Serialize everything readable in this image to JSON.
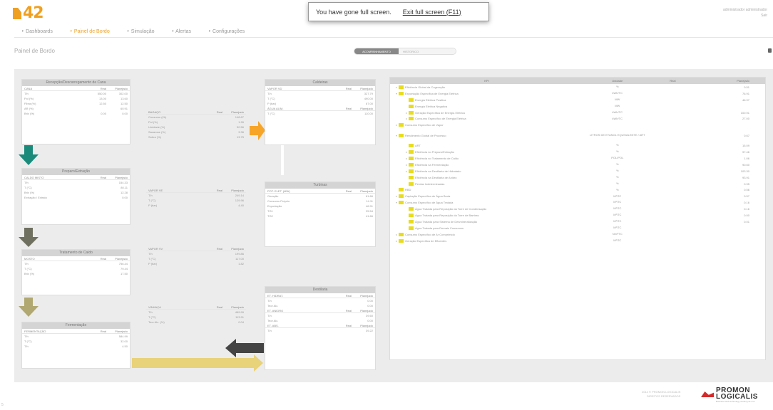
{
  "app": {
    "logo_text": "42",
    "user_line1": "administrador administrador",
    "user_line2": "Sair"
  },
  "fullscreen": {
    "message": "You have gone full screen.",
    "exit_label": "Exit full screen (F11)"
  },
  "nav": [
    {
      "label": "‣ Dashboards"
    },
    {
      "label": "‣ Painel de Bordo"
    },
    {
      "label": "‣ Simulação"
    },
    {
      "label": "‣ Alertas"
    },
    {
      "label": "‣ Configurações"
    }
  ],
  "page": {
    "title": "Painel de Bordo",
    "toggle_on": "ACOMPANHAMENTO",
    "toggle_off": "HISTORICO"
  },
  "panels": {
    "recepcao": {
      "title": "Recepção/Descarregamento de Cana",
      "cols": [
        "CANA",
        "Real",
        "Planejado"
      ],
      "rows": [
        [
          "T/h",
          "550.00",
          "302.00"
        ],
        [
          "Pol (%)",
          "13.00",
          "13.60"
        ],
        [
          "Fibra (%)",
          "12.50",
          "12.50"
        ],
        [
          "AR (%)",
          "",
          "60.91"
        ],
        [
          "Brix (%)",
          "0.00",
          "0.00"
        ]
      ]
    },
    "preparo": {
      "title": "Preparo/Extração",
      "cols": [
        "CALDO MISTO",
        "Real",
        "Planejado"
      ],
      "rows": [
        [
          "T/h",
          "",
          "154.33"
        ],
        [
          "T (°C)",
          "",
          "80.11"
        ],
        [
          "Brix (%)",
          "",
          "12.28"
        ],
        [
          "Extração / Extrato",
          "",
          "0.00"
        ]
      ]
    },
    "tratamento": {
      "title": "Tratamento de Caldo",
      "cols": [
        "MOSTO",
        "Real",
        "Planejado"
      ],
      "rows": [
        [
          "T/h",
          "",
          "756.44"
        ],
        [
          "T (°C)",
          "",
          "79.44"
        ],
        [
          "Brix (%)",
          "",
          "17.50"
        ]
      ]
    },
    "fermentacao": {
      "title": "Fermentação",
      "cols": [
        "FERMENTAÇÃO",
        "Real",
        "Planejado"
      ],
      "rows": [
        [
          "T/h",
          "",
          "584.99"
        ],
        [
          "T (°C)",
          "",
          "32.00"
        ],
        [
          "T/h",
          "",
          "4.50"
        ]
      ]
    },
    "bagaco": {
      "cols": [
        "BAGAÇO",
        "Real",
        "Planejado"
      ],
      "rows": [
        [
          "Consumo (t/h)",
          "",
          "148.87"
        ],
        [
          "Pol (%)",
          "",
          "1.26"
        ],
        [
          "Umidade (%)",
          "",
          "50.56"
        ],
        [
          "Sacarose (%)",
          "",
          "3.36"
        ],
        [
          "Sobra (%)",
          "",
          "13.75"
        ]
      ]
    },
    "vapor_ve": {
      "cols": [
        "VAPOR VE",
        "Real",
        "Planejado"
      ],
      "rows": [
        [
          "T/h",
          "",
          "249.14"
        ],
        [
          "T (°C)",
          "",
          "129.96"
        ],
        [
          "P (bar)",
          "",
          "4.40"
        ]
      ]
    },
    "vapor_vv": {
      "cols": [
        "VAPOR VV",
        "Real",
        "Planejado"
      ],
      "rows": [
        [
          "T/h",
          "",
          "199.86"
        ],
        [
          "T (°C)",
          "",
          "117.00"
        ],
        [
          "P (bar)",
          "",
          "1.82"
        ]
      ]
    },
    "vinhaca": {
      "cols": [
        "VINHAÇA",
        "Real",
        "Planejado"
      ],
      "rows": [
        [
          "T/h",
          "",
          "469.99"
        ],
        [
          "T (°C)",
          "",
          "113.91"
        ],
        [
          "Teor Alc. (%)",
          "",
          "0.04"
        ]
      ]
    },
    "caldeiras": {
      "title": "Caldeiras",
      "cols": [
        "VAPOR VD",
        "Real",
        "Planejado"
      ],
      "rows": [
        [
          "T/h",
          "",
          "327.79"
        ],
        [
          "T (°C)",
          "",
          "490.00"
        ],
        [
          "P (bar)",
          "",
          "67.00"
        ]
      ],
      "cols2": [
        "ÁGUA ALIM.",
        "Real",
        "Planejado"
      ],
      "rows2": [
        [
          "T (°C)",
          "",
          "110.00"
        ]
      ]
    },
    "turbinas": {
      "title": "Turbinas",
      "cols": [
        "POT. ELET. (MW)",
        "Real",
        "Planejado"
      ],
      "rows": [
        [
          "Geração",
          "",
          "61.66"
        ],
        [
          "Consumo Próprio",
          "",
          "14.11"
        ],
        [
          "Exportação",
          "",
          "46.91"
        ],
        [
          "TG1",
          "",
          "25.54"
        ],
        [
          "TG2",
          "",
          "41.66"
        ]
      ]
    },
    "destilaria": {
      "title": "Destilaria",
      "cols": [
        "ET. HIDRAT.",
        "Real",
        "Planejado"
      ],
      "rows": [
        [
          "T/h",
          "",
          "0.00"
        ],
        [
          "Teor Alc.",
          "",
          "0.00"
        ]
      ],
      "cols2": [
        "ET. ANIDRO",
        "Real",
        "Planejado"
      ],
      "rows2": [
        [
          "T/h",
          "",
          "39.60"
        ],
        [
          "Teor Alc.",
          "",
          "0.00"
        ]
      ],
      "cols3": [
        "ET. ABS.",
        "Real",
        "Planejado"
      ],
      "rows3": [
        [
          "T/h",
          "",
          "39.22"
        ]
      ]
    }
  },
  "kpi": {
    "headers": [
      "KPI",
      "Unidade",
      "Real",
      "Planejado"
    ],
    "rows": [
      {
        "tw": "▸",
        "indent": 0,
        "label": "Eficiência Global da Cogeração",
        "unit": "%",
        "real": "",
        "plan": "0.51"
      },
      {
        "tw": "▾",
        "indent": 0,
        "label": "Exportação Específica de Energia Elétrica",
        "unit": "kWh/TC",
        "real": "",
        "plan": "76.91"
      },
      {
        "tw": "",
        "indent": 1,
        "label": "Energia Elétrica Positiva",
        "unit": "MW",
        "real": "",
        "plan": "46.97"
      },
      {
        "tw": "",
        "indent": 1,
        "label": "Energia Elétrica Negativa",
        "unit": "MW",
        "real": "",
        "plan": ""
      },
      {
        "tw": "▸",
        "indent": 1,
        "label": "Geração Específica de Energia Elétrica",
        "unit": "kWh/TC",
        "real": "",
        "plan": "100.91"
      },
      {
        "tw": "▸",
        "indent": 1,
        "label": "Consumo Específico de Energia Elétrica",
        "unit": "kWh/TC",
        "real": "",
        "plan": "27.00"
      },
      {
        "tw": "▸",
        "indent": 0,
        "label": "Consumo Específico de Vapor",
        "unit": "",
        "real": "",
        "plan": ""
      },
      {
        "tw": "▾",
        "indent": 0,
        "label": "Rendimento Global de Processo",
        "unit": "LITROS DE ETANOL EQUIVALENTE / ART",
        "real": "",
        "plan": "0.67",
        "tall": true
      },
      {
        "tw": "",
        "indent": 1,
        "label": "ART",
        "unit": "%",
        "real": "",
        "plan": "15.09"
      },
      {
        "tw": "▸",
        "indent": 1,
        "label": "Eficiência no Preparo/Extração",
        "unit": "%",
        "real": "",
        "plan": "97.46"
      },
      {
        "tw": "▸",
        "indent": 1,
        "label": "Eficiência no Tratamento de Caldo",
        "unit": "POL/POL",
        "real": "",
        "plan": "1.06"
      },
      {
        "tw": "▸",
        "indent": 1,
        "label": "Eficiência na Fermentação",
        "unit": "%",
        "real": "",
        "plan": "90.60"
      },
      {
        "tw": "▸",
        "indent": 1,
        "label": "Eficiência na Destilaria de Hidratado",
        "unit": "%",
        "real": "",
        "plan": "103.30"
      },
      {
        "tw": "",
        "indent": 1,
        "label": "Eficiência na Destilaria de Anidro",
        "unit": "%",
        "real": "",
        "plan": "93.91"
      },
      {
        "tw": "",
        "indent": 1,
        "label": "Perdas Indeterminadas",
        "unit": "%",
        "real": "",
        "plan": "0.95"
      },
      {
        "tw": "",
        "indent": 0,
        "label": "RBD",
        "unit": "%",
        "real": "",
        "plan": "0.56"
      },
      {
        "tw": "▸",
        "indent": 0,
        "label": "Captação Específica de Água Bruta",
        "unit": "M³/TC",
        "real": "",
        "plan": "0.57"
      },
      {
        "tw": "▾",
        "indent": 0,
        "label": "Consumo Específico de Água Tratada",
        "unit": "M³/TC",
        "real": "",
        "plan": "0.16"
      },
      {
        "tw": "",
        "indent": 1,
        "label": "Água Tratada para Reposição da Torre de Condensação",
        "unit": "M³/TC",
        "real": "",
        "plan": "0.16"
      },
      {
        "tw": "",
        "indent": 1,
        "label": "Água Tratada para Reposição da Torre de Barriras",
        "unit": "M³/TC",
        "real": "",
        "plan": "0.00"
      },
      {
        "tw": "",
        "indent": 1,
        "label": "Água Tratada para Sistema de Desmineralização",
        "unit": "M³/TC",
        "real": "",
        "plan": "0.01"
      },
      {
        "tw": "",
        "indent": 1,
        "label": "Água Tratada para Demais Consumos",
        "unit": "M³/TC",
        "real": "",
        "plan": ""
      },
      {
        "tw": "▸",
        "indent": 0,
        "label": "Consumo Específico de Ar Comprimido",
        "unit": "Nm³/TC",
        "real": "",
        "plan": ""
      },
      {
        "tw": "▸",
        "indent": 0,
        "label": "Geração Específica de Efluentes",
        "unit": "M³/TC",
        "real": "",
        "plan": ""
      }
    ]
  },
  "footer": {
    "line1": "2014 © PROMON LOGICALIS",
    "line2": "DIREITOS RESERVADOS",
    "brand_line1": "PROMON",
    "brand_line2": "LOGICALIS",
    "brand_sub": "Business and technology working as one",
    "corner": "5"
  },
  "colors": {
    "accent": "#f0a020",
    "arrow_teal": "#1a8a7a",
    "arrow_olive": "#8a8a70",
    "arrow_khaki": "#b0a870",
    "arrow_gold": "#e8d27a",
    "arrow_orange": "#f7a528",
    "arrow_dark": "#444444"
  }
}
